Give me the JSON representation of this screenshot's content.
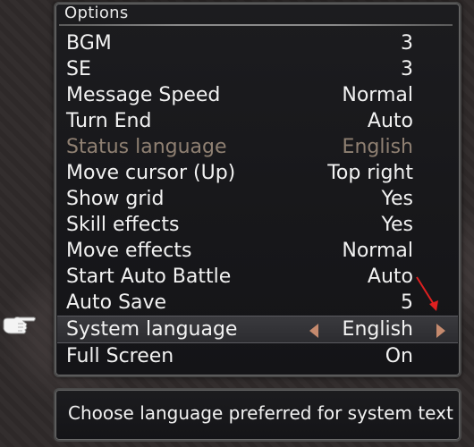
{
  "panel": {
    "title": "Options"
  },
  "options": [
    {
      "label": "BGM",
      "value": "3"
    },
    {
      "label": "SE",
      "value": "3"
    },
    {
      "label": "Message Speed",
      "value": "Normal"
    },
    {
      "label": "Turn End",
      "value": "Auto"
    },
    {
      "label": "Status language",
      "value": "English"
    },
    {
      "label": "Move cursor (Up)",
      "value": "Top right"
    },
    {
      "label": "Show grid",
      "value": "Yes"
    },
    {
      "label": "Skill effects",
      "value": "Yes"
    },
    {
      "label": "Move effects",
      "value": "Normal"
    },
    {
      "label": "Start Auto Battle",
      "value": "Auto"
    },
    {
      "label": "Auto Save",
      "value": "5"
    },
    {
      "label": "System language",
      "value": "English"
    },
    {
      "label": "Full Screen",
      "value": "On"
    }
  ],
  "help": {
    "text": "Choose language preferred for system text"
  },
  "icons": {
    "cursor": "pointing-hand-icon",
    "prev": "arrow-left-icon",
    "next": "arrow-right-icon"
  },
  "colors": {
    "text": "#f2f2f2",
    "disabled": "#8f8072",
    "arrow": "#c58a6e"
  }
}
